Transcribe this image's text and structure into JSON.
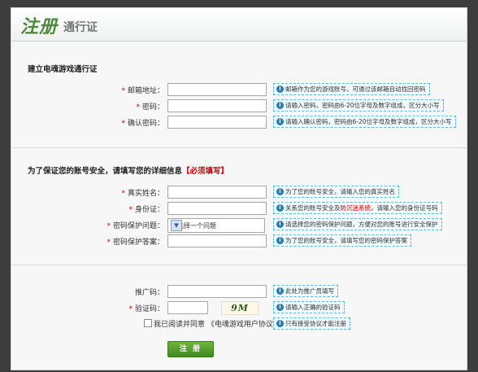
{
  "header": {
    "logo_main": "注册",
    "logo_sub": "通行证"
  },
  "section1": {
    "title": "建立电魂游戏通行证",
    "rows": [
      {
        "label": "邮箱地址：",
        "value": "",
        "hint": "邮箱作为您的游戏账号，可通过该邮箱自动找回密码"
      },
      {
        "label": "密码：",
        "value": "",
        "hint": "请输入密码，密码由6-20位字母及数字组成，区分大小写"
      },
      {
        "label": "确认密码：",
        "value": "",
        "hint": "请输入确认密码，密码由6-20位字母及数字组成，区分大小写"
      }
    ]
  },
  "section2": {
    "title": "为了保证您的账号安全，请填写您的详细信息",
    "required_note": "【必须填写】",
    "rows": [
      {
        "label": "真实姓名：",
        "value": "",
        "hint": "为了您的账号安全，请输入您的真实姓名"
      },
      {
        "label": "身份证：",
        "value": "",
        "hint_a": "关系您的账号安全及",
        "hint_em": "防沉迷系统",
        "hint_b": "，请输入您的身份证号码"
      },
      {
        "label": "密码保护问题：",
        "selected": "请选择一个问题",
        "hint": "请选择您的密码保护问题，方便对您的账号进行安全保护"
      },
      {
        "label": "密码保护答案：",
        "value": "",
        "hint": "为了您的账号安全，请填写您的密码保护答案"
      }
    ]
  },
  "section3": {
    "promo": {
      "label": "推广码：",
      "value": "",
      "hint": "此处为推广员填写"
    },
    "captcha": {
      "label": "验证码：",
      "value": "",
      "image_text": "9M",
      "hint": "请输入正确的验证码"
    },
    "agree": {
      "text": "我已阅读并同意 《电魂游戏用户协议》",
      "hint": "只有接受协议才能注册"
    },
    "submit_label": "注 册"
  },
  "colors": {
    "background": "#3d3d3d",
    "accent_green": "#4d8a3a",
    "required_red": "#d40000",
    "hint_border": "#6bb7d6"
  },
  "icons": {
    "info": "info-circle-icon",
    "dropdown": "chevron-down-icon"
  }
}
